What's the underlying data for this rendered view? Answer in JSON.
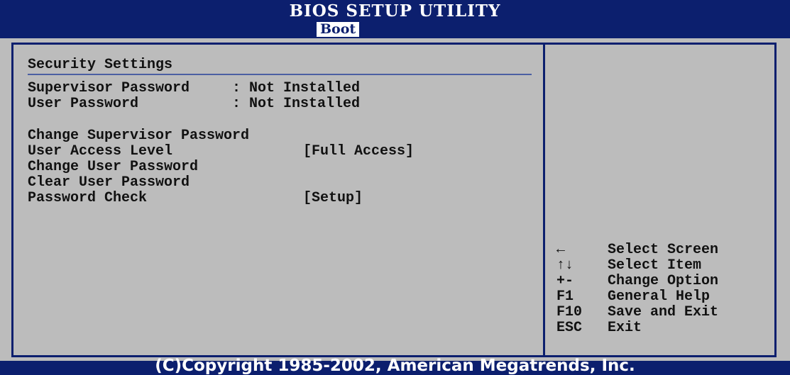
{
  "header": {
    "title": "BIOS SETUP UTILITY",
    "active_tab": "Boot"
  },
  "main": {
    "section_title": "Security Settings",
    "status": [
      {
        "label": "Supervisor Password",
        "value": ": Not Installed"
      },
      {
        "label": "User Password",
        "value": ": Not Installed"
      }
    ],
    "items": [
      {
        "label": "Change Supervisor Password",
        "value": ""
      },
      {
        "label": "User Access Level",
        "value": "[Full Access]"
      },
      {
        "label": "Change User Password",
        "value": ""
      },
      {
        "label": "Clear User Password",
        "value": ""
      },
      {
        "label": "Password Check",
        "value": "[Setup]"
      }
    ]
  },
  "help": [
    {
      "key": "←",
      "icon": "left-arrow-icon",
      "text": "Select Screen"
    },
    {
      "key": "↑↓",
      "icon": "up-down-arrows-icon",
      "text": "Select Item"
    },
    {
      "key": "+-",
      "text": "Change Option"
    },
    {
      "key": "F1",
      "text": "General Help"
    },
    {
      "key": "F10",
      "text": "Save and Exit"
    },
    {
      "key": "ESC",
      "text": "Exit"
    }
  ],
  "footer": {
    "copyright": "(C)Copyright 1985-2002, American Megatrends, Inc."
  },
  "colors": {
    "background": "#bcbcbc",
    "header": "#0c1f6e",
    "text": "#111111",
    "highlight": "#ffffff"
  }
}
